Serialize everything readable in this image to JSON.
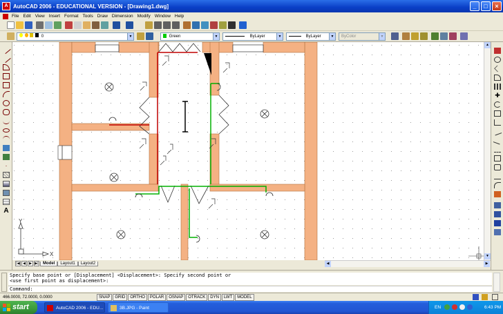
{
  "window": {
    "title": "AutoCAD 2006 - EDUCATIONAL VERSION - [Drawing1.dwg]",
    "app_icon_letter": "A"
  },
  "menu": [
    "File",
    "Edit",
    "View",
    "Insert",
    "Format",
    "Tools",
    "Draw",
    "Dimension",
    "Modify",
    "Window",
    "Help"
  ],
  "layers_toolbar": {
    "layer_value": "0",
    "color_value": "Green",
    "linetype_value": "ByLayer",
    "lineweight_value": "ByLayer",
    "plotstyle_value": "ByColor"
  },
  "canvas": {
    "ucs_y_label": "Y",
    "ucs_x_label": "X",
    "colors": {
      "wall": "#f4b183",
      "red_wire": "#c00000",
      "green_wire": "#00b000"
    }
  },
  "layout_tabs": [
    {
      "label": "Model",
      "active": true
    },
    {
      "label": "Layout1",
      "active": false
    },
    {
      "label": "Layout2",
      "active": false
    }
  ],
  "command_window": {
    "history_line1": "Specify base point or [Displacement] <Displacement>: Specify second point or",
    "history_line2": "<use first point as displacement>:",
    "prompt": "Command:"
  },
  "status": {
    "coordinates": "466.0000, 72.0000, 0.0000",
    "toggles": [
      "SNAP",
      "GRID",
      "ORTHO",
      "POLAR",
      "OSNAP",
      "OTRACK",
      "DYN",
      "LWT",
      "MODEL"
    ]
  },
  "taskbar": {
    "start_label": "start",
    "tasks": [
      {
        "label": "AutoCAD 2006 - EDU...",
        "active": true
      },
      {
        "label": "3B.JPG - Paint",
        "active": false
      }
    ],
    "language": "EN",
    "clock": "6:43 PM"
  }
}
